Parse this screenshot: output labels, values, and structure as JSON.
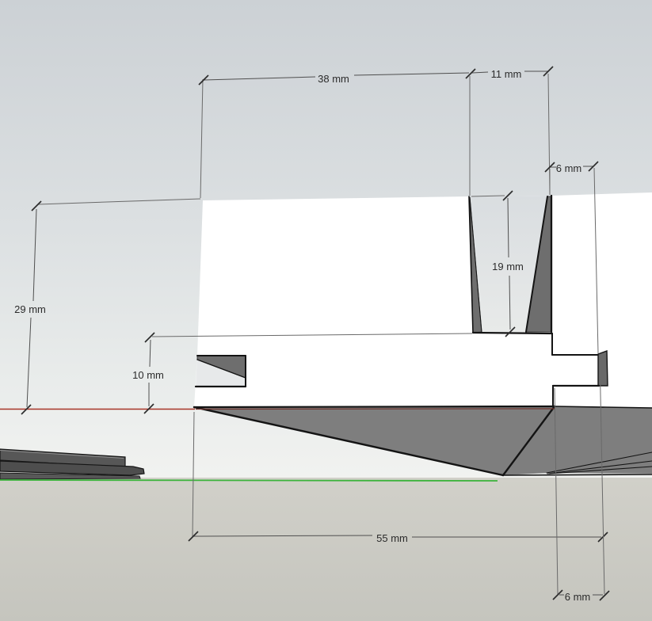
{
  "viewport": {
    "type": "3d-cad-viewport"
  },
  "labels": {
    "d38": "38 mm",
    "d11": "11 mm",
    "d6t": "6 mm",
    "d19": "19 mm",
    "d29": "29 mm",
    "d10": "10 mm",
    "d55": "55 mm",
    "d6b": "6 mm"
  },
  "axes": {
    "red": "#a83527",
    "red_hidden": "#6e332c",
    "green": "#3bb33b"
  },
  "colors": {
    "cut_face": "#ffffff",
    "shaded_face": "#7e7e7e",
    "wedge_face": "#6e6e6e",
    "sky_top": "#ccd1d5",
    "ground": "#cbcac3"
  }
}
